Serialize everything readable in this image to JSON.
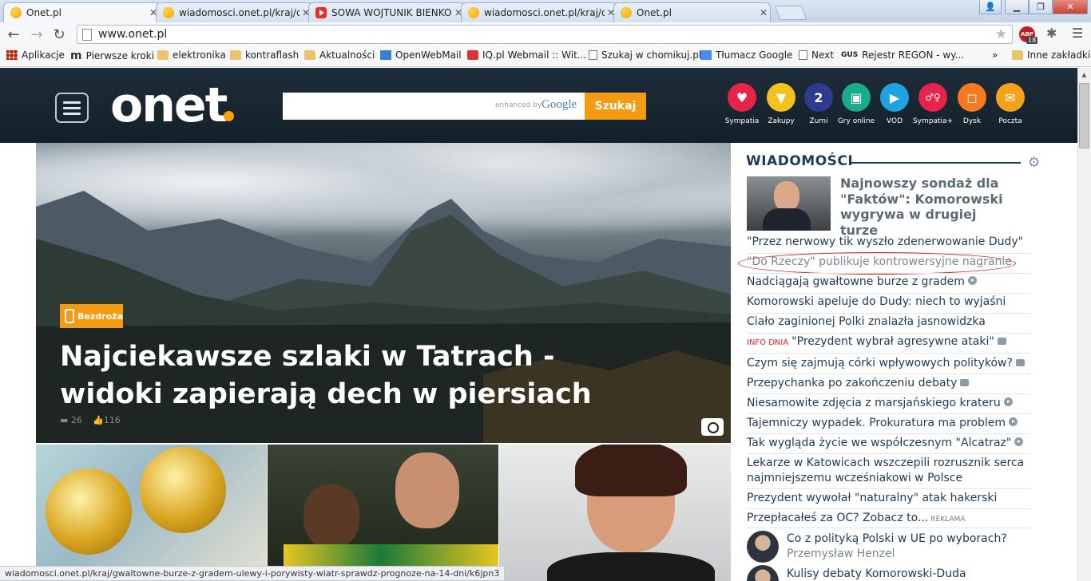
{
  "tabs": [
    {
      "title": "Onet.pl",
      "favicon": "onet",
      "active": true
    },
    {
      "title": "wiadomosci.onet.pl/kraj/d",
      "favicon": "onet",
      "active": false
    },
    {
      "title": "SOWA WOJTUNIK BIENKO",
      "favicon": "youtube",
      "active": false
    },
    {
      "title": "wiadomosci.onet.pl/kraj/d",
      "favicon": "onet",
      "active": false
    },
    {
      "title": "Onet.pl",
      "favicon": "onet",
      "active": false
    }
  ],
  "toolbar": {
    "url": "www.onet.pl",
    "abp_label": "ABP",
    "abp_count": "18"
  },
  "bookmarks": [
    {
      "label": "Aplikacje",
      "icon": "apps-icon"
    },
    {
      "label": "Pierwsze kroki",
      "icon": "m-icon"
    },
    {
      "label": "elektronika",
      "icon": "folder-icon"
    },
    {
      "label": "kontraflash",
      "icon": "folder-icon"
    },
    {
      "label": "Aktualności",
      "icon": "folder-icon"
    },
    {
      "label": "OpenWebMail",
      "icon": "mail-icon"
    },
    {
      "label": "IQ.pl Webmail :: Wit...",
      "icon": "iq-icon"
    },
    {
      "label": "Szukaj w chomikuj.pl",
      "icon": "page-icon"
    },
    {
      "label": "Tłumacz Google",
      "icon": "translate-icon"
    },
    {
      "label": "Next",
      "icon": "page-icon"
    },
    {
      "label": "Rejestr REGON - wy...",
      "icon": "regon-icon"
    }
  ],
  "bookmarks_more": "»",
  "bookmarks_other": "Inne zakładki",
  "header": {
    "logo": "onet",
    "search_enhanced": "enhanced by",
    "search_google": "Google",
    "search_button": "Szukaj",
    "services": [
      {
        "label": "Sympatia",
        "color": "#e8234a",
        "glyph": "♥"
      },
      {
        "label": "Zakupy",
        "color": "#f4c21e",
        "glyph": "▼"
      },
      {
        "label": "Zumi",
        "color": "#2e3b8f",
        "glyph": "2"
      },
      {
        "label": "Gry online",
        "color": "#1aab8b",
        "glyph": "▣"
      },
      {
        "label": "VOD",
        "color": "#1fa3e0",
        "glyph": "▶"
      },
      {
        "label": "Sympatia+",
        "color": "#e8234a",
        "glyph": "♂♀"
      },
      {
        "label": "Dysk",
        "color": "#f47a20",
        "glyph": "◻"
      },
      {
        "label": "Poczta",
        "color": "#f6a11a",
        "glyph": "✉"
      }
    ]
  },
  "hero": {
    "badge": "Bezdroża",
    "title": "Najciekawsze szlaki w Tatrach - widoki zapierają dech w piersiach",
    "comments": "26",
    "likes": "116"
  },
  "news": {
    "section_title": "WIADOMOŚCI",
    "lead_title": "Najnowszy sondaż dla \"Faktów\": Komorowski wygrywa w drugiej turze",
    "items": [
      {
        "text": "\"Przez nerwowy tik wyszło zdenerwowanie Dudy\"",
        "tag": "",
        "icon": "",
        "gray": false
      },
      {
        "text": "\"Do Rzeczy\" publikuje kontrowersyjne nagranie",
        "tag": "",
        "icon": "",
        "gray": true
      },
      {
        "text": "Nadciągają gwałtowne burze z gradem",
        "tag": "",
        "icon": "play",
        "gray": false
      },
      {
        "text": "Komorowski apeluje do Dudy: niech to wyjaśni",
        "tag": "",
        "icon": "",
        "gray": false
      },
      {
        "text": "Ciało zaginionej Polki znalazła jasnowidzka",
        "tag": "",
        "icon": "",
        "gray": false
      },
      {
        "text": "\"Prezydent wybrał agresywne ataki\"",
        "tag": "INFO DNIA",
        "icon": "photo",
        "gray": false
      },
      {
        "text": "Czym się zajmują córki wpływowych polityków?",
        "tag": "",
        "icon": "photo",
        "gray": false
      },
      {
        "text": "Przepychanka po zakończeniu debaty",
        "tag": "",
        "icon": "photo",
        "gray": false
      },
      {
        "text": "Niesamowite zdjęcia z marsjańskiego krateru",
        "tag": "",
        "icon": "play",
        "gray": false
      },
      {
        "text": "Tajemniczy wypadek. Prokuratura ma problem",
        "tag": "",
        "icon": "play",
        "gray": false
      },
      {
        "text": "Tak wygląda życie we współczesnym \"Alcatraz\"",
        "tag": "",
        "icon": "play",
        "gray": false
      },
      {
        "text": "Lekarze w Katowicach wszczepili rozrusznik serca",
        "tag": "",
        "icon": "",
        "gray": false
      },
      {
        "text": "najmniejszemu wcześniakowi w Polsce",
        "tag": "",
        "icon": "",
        "gray": false
      },
      {
        "text": "Prezydent wywołał \"naturalny\" atak hakerski",
        "tag": "",
        "icon": "",
        "gray": false
      },
      {
        "text": "Przepłacałeś za OC? Zobacz to...",
        "tag": "",
        "icon": "ad",
        "gray": false
      }
    ],
    "ad_label": "REKLAMA",
    "authors": [
      {
        "title": "Co z polityką Polski w UE po wyborach?",
        "name": "Przemysław Henzel"
      },
      {
        "title": "Kulisy debaty Komorowski-Duda",
        "name": ""
      }
    ]
  },
  "statusbar": "wiadomosci.onet.pl/kraj/gwaltowne-burze-z-gradem-ulewy-i-porywisty-wiatr-sprawdz-prognoze-na-14-dni/k6jpn3"
}
